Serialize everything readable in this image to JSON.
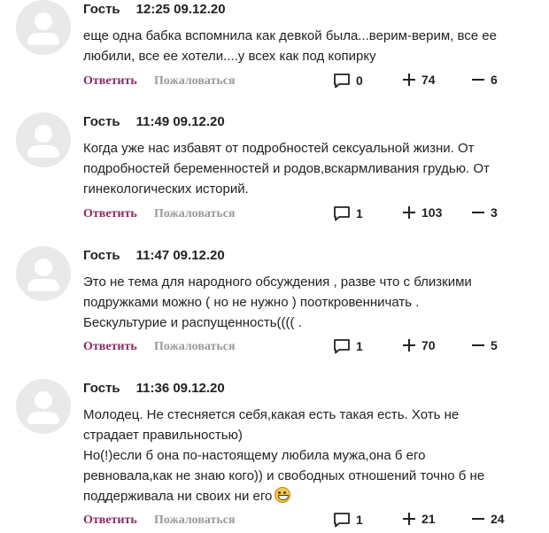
{
  "comments": [
    {
      "author": "Гость",
      "time": "12:25 09.12.20",
      "lines": [
        "еще одна бабка вспомнила как девкой была...верим-верим, все ее",
        "любили, все ее хотели....у всех как под копирку"
      ],
      "reply_label": "Ответить",
      "report_label": "Пожаловаться",
      "replies": "0",
      "likes": "74",
      "dislikes": "6"
    },
    {
      "author": "Гость",
      "time": "11:49 09.12.20",
      "lines": [
        "Когда уже нас избавят от подробностей сексуальной жизни. От",
        "подробностей беременностей и родов,вскармливания грудью. От",
        "гинекологических историй."
      ],
      "reply_label": "Ответить",
      "report_label": "Пожаловаться",
      "replies": "1",
      "likes": "103",
      "dislikes": "3"
    },
    {
      "author": "Гость",
      "time": "11:47 09.12.20",
      "lines": [
        "Это не тема для народного обсуждения , разве что с близкими",
        "подружками можно ( но не нужно ) пооткровенничать .",
        "Бескультурие и распущенность(((( ."
      ],
      "reply_label": "Ответить",
      "report_label": "Пожаловаться",
      "replies": "1",
      "likes": "70",
      "dislikes": "5"
    },
    {
      "author": "Гость",
      "time": "11:36 09.12.20",
      "lines": [
        "Молодец. Не стесняется себя,какая есть такая есть. Хоть не",
        "страдает правильностью)",
        "Но(!)если б она по-настоящему любила мужа,она б его",
        "ревновала,как не знаю кого)) и свободных отношений точно б не",
        "поддерживала ни своих ни его"
      ],
      "emoji": "grinning-face-emoji",
      "reply_label": "Ответить",
      "report_label": "Пожаловаться",
      "replies": "1",
      "likes": "21",
      "dislikes": "24"
    }
  ],
  "icons": {
    "replies": "comment-bubble-icon",
    "likes": "plus-icon",
    "dislikes": "minus-icon"
  },
  "colors": {
    "reply_link": "#8a2c66",
    "report_link": "#9a9a9a",
    "avatar_bg": "#e9e9e9"
  }
}
